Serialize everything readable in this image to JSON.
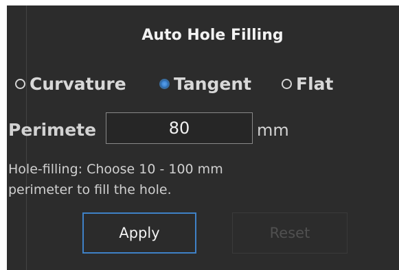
{
  "dialog": {
    "title": "Auto Hole Filling",
    "modes": [
      {
        "label": "Curvature",
        "selected": false
      },
      {
        "label": "Tangent",
        "selected": true
      },
      {
        "label": "Flat",
        "selected": false
      }
    ],
    "perimeter": {
      "label": "Perimete",
      "value": "80",
      "unit": "mm"
    },
    "hint": {
      "line1": "Hole-filling:  Choose 10 - 100 mm",
      "line2": "perimeter to fill the hole."
    },
    "buttons": {
      "apply": "Apply",
      "reset": "Reset"
    }
  },
  "colors": {
    "background": "#2c2c2c",
    "accent": "#3f87d6",
    "text": "#d8d8d8",
    "disabled_text": "#505050"
  }
}
